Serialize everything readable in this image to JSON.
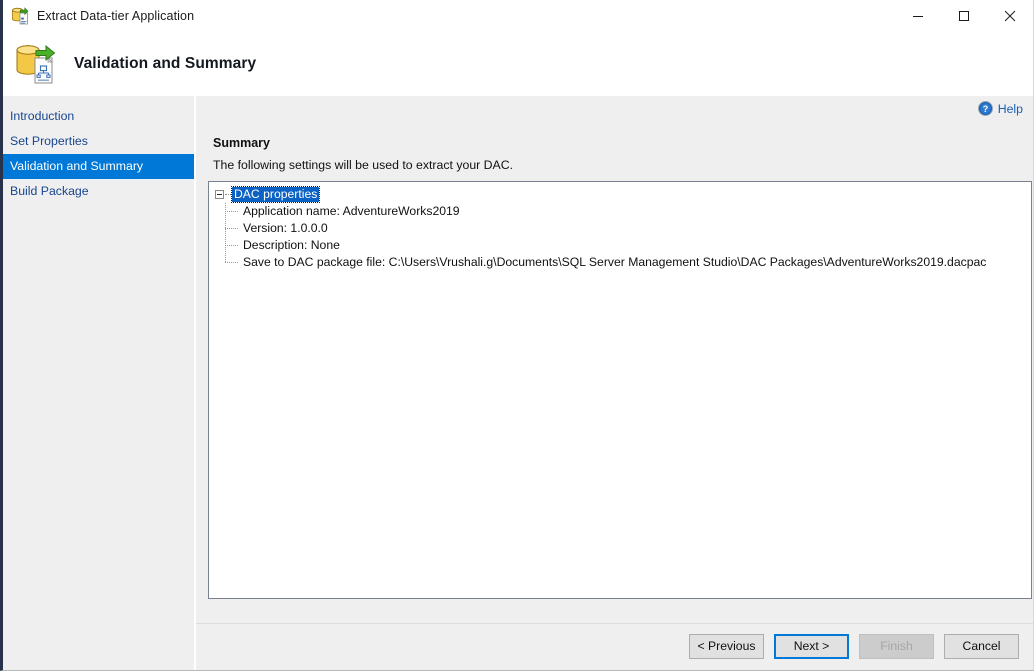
{
  "window": {
    "title": "Extract Data-tier Application",
    "icon": "database-extract-icon",
    "controls": {
      "minimize": "minimize-icon",
      "maximize": "maximize-icon",
      "close": "close-icon"
    }
  },
  "header": {
    "title": "Validation and Summary",
    "icon": "database-extract-large-icon"
  },
  "sidebar": {
    "items": [
      {
        "label": "Introduction",
        "selected": false
      },
      {
        "label": "Set Properties",
        "selected": false
      },
      {
        "label": "Validation and Summary",
        "selected": true
      },
      {
        "label": "Build Package",
        "selected": false
      }
    ]
  },
  "content": {
    "help": {
      "label": "Help",
      "icon": "help-circle-icon"
    },
    "summary_heading": "Summary",
    "summary_description": "The following settings will be used to extract your DAC.",
    "tree": {
      "root": {
        "label": "DAC properties",
        "expanded": true,
        "selected": true
      },
      "children": [
        "Application name: AdventureWorks2019",
        "Version: 1.0.0.0",
        "Description: None",
        "Save to DAC package file: C:\\Users\\Vrushali.g\\Documents\\SQL Server Management Studio\\DAC Packages\\AdventureWorks2019.dacpac"
      ]
    }
  },
  "footer": {
    "buttons": [
      {
        "label": "< Previous",
        "state": "enabled"
      },
      {
        "label": "Next >",
        "state": "focused"
      },
      {
        "label": "Finish",
        "state": "disabled"
      },
      {
        "label": "Cancel",
        "state": "enabled"
      }
    ]
  },
  "colors": {
    "accent": "#0078d7",
    "selection": "#0b62c4",
    "link": "#18458f",
    "sidebar_bg": "#efefef",
    "titlebar_border": "#27334a"
  }
}
